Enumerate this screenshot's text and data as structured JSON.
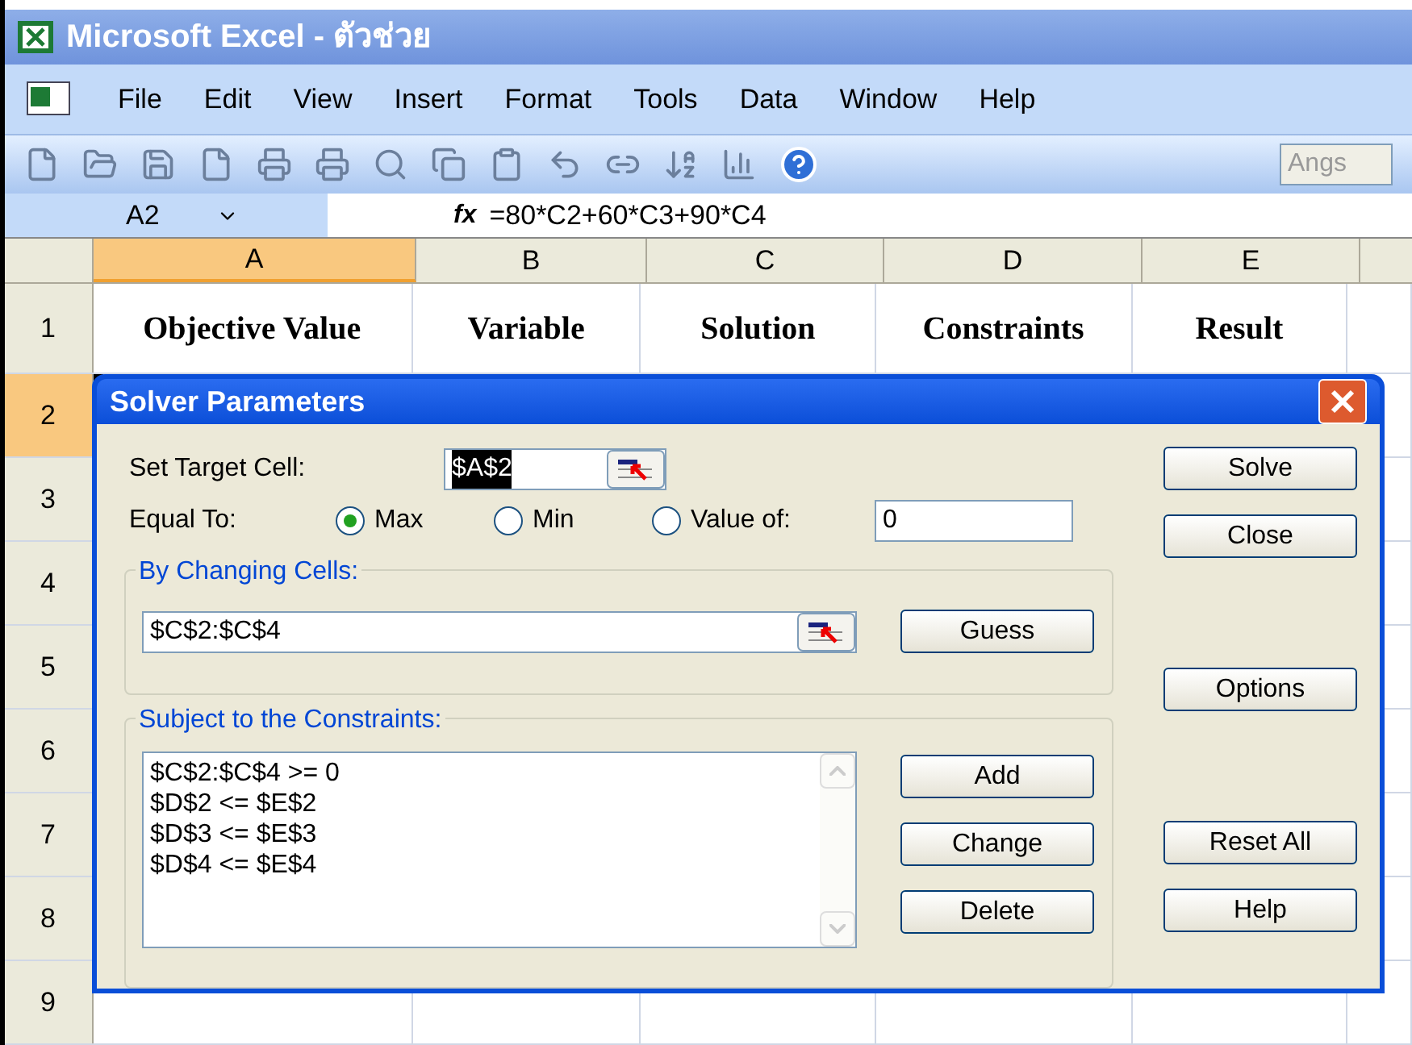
{
  "window": {
    "title": "Microsoft Excel - ตัวช่วย"
  },
  "menu": [
    "File",
    "Edit",
    "View",
    "Insert",
    "Format",
    "Tools",
    "Data",
    "Window",
    "Help"
  ],
  "toolbar": {
    "font_box": "Angs"
  },
  "formula_bar": {
    "name_box": "A2",
    "fx": "fx",
    "formula": "=80*C2+60*C3+90*C4"
  },
  "sheet": {
    "columns": [
      {
        "label": "A",
        "selected": true
      },
      {
        "label": "B",
        "selected": false
      },
      {
        "label": "C",
        "selected": false
      },
      {
        "label": "D",
        "selected": false
      },
      {
        "label": "E",
        "selected": false
      }
    ],
    "rows": [
      {
        "label": "1",
        "selected": false,
        "cells": [
          "Objective Value",
          "Variable",
          "Solution",
          "Constraints",
          "Result"
        ]
      },
      {
        "label": "2",
        "selected": true,
        "cells": []
      },
      {
        "label": "3",
        "selected": false,
        "cells": []
      },
      {
        "label": "4",
        "selected": false,
        "cells": []
      },
      {
        "label": "5",
        "selected": false,
        "cells": []
      },
      {
        "label": "6",
        "selected": false,
        "cells": []
      },
      {
        "label": "7",
        "selected": false,
        "cells": []
      },
      {
        "label": "8",
        "selected": false,
        "cells": []
      },
      {
        "label": "9",
        "selected": false,
        "cells": []
      }
    ]
  },
  "dialog": {
    "title": "Solver Parameters",
    "target_label": "Set Target Cell:",
    "target_value": "$A$2",
    "equal_label": "Equal To:",
    "options": [
      {
        "label": "Max",
        "selected": true
      },
      {
        "label": "Min",
        "selected": false
      },
      {
        "label": "Value of:",
        "selected": false
      }
    ],
    "value_of": "0",
    "changing_label": "By Changing Cells:",
    "changing_value": "$C$2:$C$4",
    "guess": "Guess",
    "constraints_label": "Subject to the Constraints:",
    "constraints": [
      "$C$2:$C$4 >= 0",
      "$D$2 <= $E$2",
      "$D$3 <= $E$3",
      "$D$4 <= $E$4"
    ],
    "constraint_buttons": [
      "Add",
      "Change",
      "Delete"
    ],
    "side_button_groups": [
      [
        "Solve",
        "Close"
      ],
      [
        "Options"
      ],
      [
        "Reset All",
        "Help"
      ]
    ]
  }
}
